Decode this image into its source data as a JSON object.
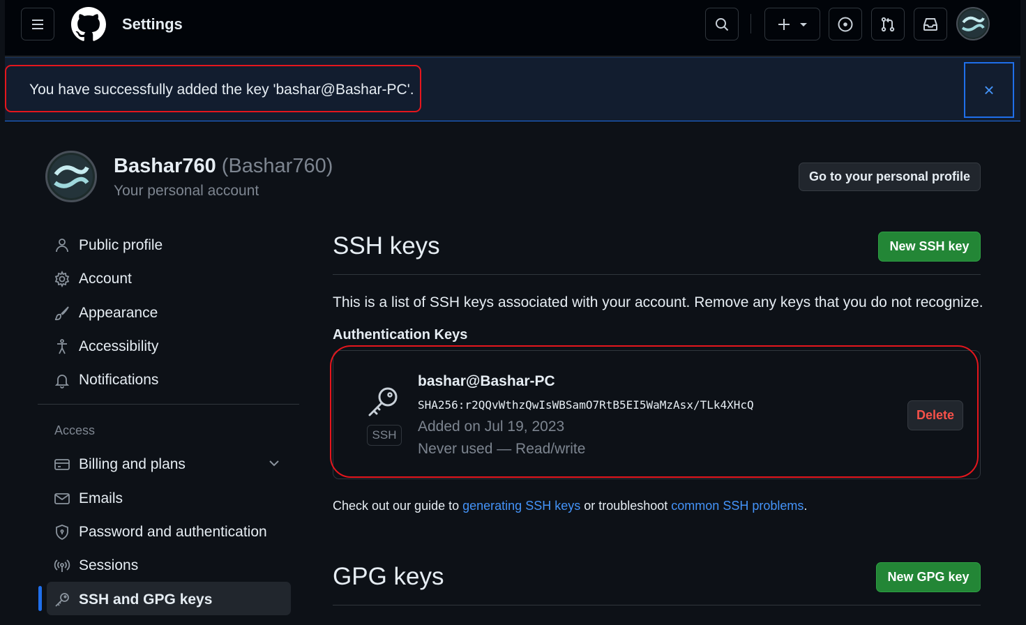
{
  "header": {
    "title": "Settings",
    "icons": [
      "menu-icon",
      "github-logo",
      "search-icon",
      "plus-icon",
      "triangle-down-icon",
      "issue-opened-icon",
      "pull-request-icon",
      "inbox-icon"
    ]
  },
  "flash": {
    "message": "You have successfully added the key 'bashar@Bashar-PC'.",
    "close_label": "×"
  },
  "account": {
    "name": "Bashar760",
    "handle": "(Bashar760)",
    "subtitle": "Your personal account",
    "profile_button": "Go to your personal profile"
  },
  "sidebar": {
    "items": [
      {
        "label": "Public profile",
        "icon": "person-icon"
      },
      {
        "label": "Account",
        "icon": "gear-icon"
      },
      {
        "label": "Appearance",
        "icon": "paintbrush-icon"
      },
      {
        "label": "Accessibility",
        "icon": "accessibility-icon"
      },
      {
        "label": "Notifications",
        "icon": "bell-icon"
      }
    ],
    "access_heading": "Access",
    "access_items": [
      {
        "label": "Billing and plans",
        "icon": "credit-card-icon"
      },
      {
        "label": "Emails",
        "icon": "mail-icon"
      },
      {
        "label": "Password and authentication",
        "icon": "shield-lock-icon"
      },
      {
        "label": "Sessions",
        "icon": "broadcast-icon"
      },
      {
        "label": "SSH and GPG keys",
        "icon": "key-icon"
      }
    ]
  },
  "ssh": {
    "title": "SSH keys",
    "new_button": "New SSH key",
    "description": "This is a list of SSH keys associated with your account. Remove any keys that you do not recognize.",
    "auth_heading": "Authentication Keys",
    "key": {
      "type_label": "SSH",
      "title": "bashar@Bashar-PC",
      "fingerprint": "SHA256:r2QQvWthzQwIsWBSamO7RtB5EI5WaMzAsx/TLk4XHcQ",
      "added": "Added on Jul 19, 2023",
      "usage": "Never used — Read/write",
      "delete_button": "Delete"
    },
    "guide_prefix": "Check out our guide to ",
    "guide_link1": "generating SSH keys",
    "guide_middle": " or troubleshoot ",
    "guide_link2": "common SSH problems",
    "guide_suffix": "."
  },
  "gpg": {
    "title": "GPG keys",
    "new_button": "New GPG key"
  },
  "colors": {
    "background": "#0d1117",
    "primary_button": "#238636",
    "link": "#4493f8",
    "danger": "#f85149",
    "highlight": "#e5161d"
  }
}
